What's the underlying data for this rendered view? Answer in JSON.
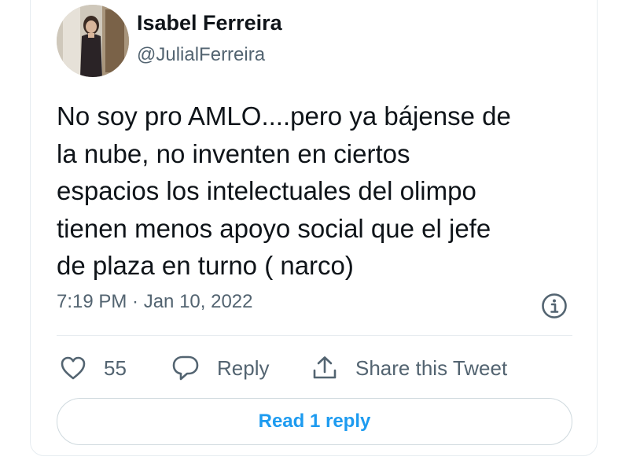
{
  "author": {
    "display_name": "Isabel Ferreira",
    "handle": "@JulialFerreira"
  },
  "tweet": {
    "text": "No soy pro AMLO....pero ya bájense de\nla nube, no inventen en ciertos\nespacios los intelectuales  del olimpo\ntienen menos apoyo social que el jefe\nde plaza en turno ( narco)",
    "timestamp": "7:19 PM · Jan 10, 2022"
  },
  "actions": {
    "like_count": "55",
    "reply_label": "Reply",
    "share_label": "Share this Tweet"
  },
  "read_replies_label": "Read 1 reply",
  "colors": {
    "text_primary": "#0f1419",
    "text_secondary": "#536471",
    "accent": "#1d9bf0",
    "border": "#e6ecf0"
  },
  "icons": {
    "info": "info-circle-icon",
    "like": "heart-outline-icon",
    "reply": "speech-bubble-icon",
    "share": "share-upload-icon"
  }
}
